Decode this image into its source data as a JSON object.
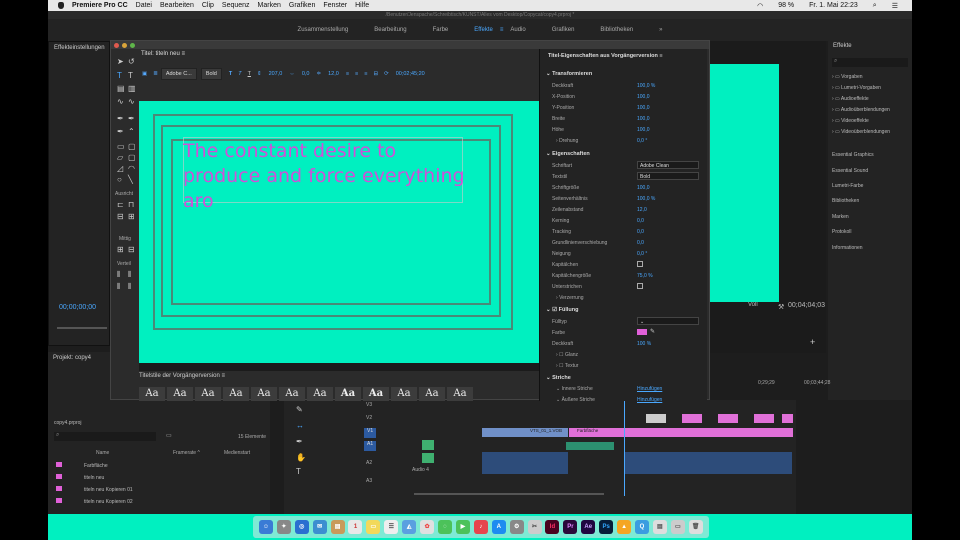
{
  "menubar": {
    "app_name": "Premiere Pro CC",
    "items": [
      "Datei",
      "Bearbeiten",
      "Clip",
      "Sequenz",
      "Marken",
      "Grafiken",
      "Fenster",
      "Hilfe"
    ],
    "battery": "98 %",
    "clock": "Fr. 1. Mai  22:23"
  },
  "path": "/Benutzer/Jenspache/Schreibtisch/KUNST/Alles vom Desktop/Copycat/copy4.prproj *",
  "workspaces": {
    "tabs": [
      "Zusammenstellung",
      "Bearbeitung",
      "Farbe",
      "Effekte",
      "Audio",
      "Grafiken",
      "Bibliotheken"
    ],
    "active": "Effekte",
    "more": "»"
  },
  "left_panel": {
    "title": "Effekteinstellungen",
    "timecode": "00;00;00;00"
  },
  "title_window": {
    "tab": "Titel: titeln neu",
    "font_family": "Adobe C...",
    "font_style": "Bold",
    "size_value": "207,0",
    "kerning_value": "0,0",
    "leading_value": "12,0",
    "timecode": "00;02;45;20",
    "text_content": "The constant desire to produce and force everything aro",
    "sections": {
      "ausrichten": "Ausricht",
      "mittig": "Mittig",
      "verteilen": "Verteil"
    }
  },
  "properties": {
    "title": "Titel-Eigenschaften aus Vorgängerversion",
    "transformieren": "Transformieren",
    "deckkraft_label": "Deckkraft",
    "deckkraft": "100,0 %",
    "xpos_label": "X-Position",
    "xpos": "100,0",
    "ypos_label": "Y-Position",
    "ypos": "100,0",
    "breite_label": "Breite",
    "breite": "100,0",
    "hoehe_label": "Höhe",
    "hoehe": "100,0",
    "drehung_label": "Drehung",
    "drehung": "0,0 °",
    "eigenschaften": "Eigenschaften",
    "schriftart_label": "Schriftart",
    "schriftart": "Adobe Clean",
    "textstil_label": "Textstil",
    "textstil": "Bold",
    "groesse_label": "Schriftgröße",
    "groesse": "100,0",
    "seiten_label": "Seitenverhältnis",
    "seiten": "100,0 %",
    "zeilen_label": "Zeilenabstand",
    "zeilen": "12,0",
    "kerning_label": "Kerning",
    "kerning": "0,0",
    "tracking_label": "Tracking",
    "tracking": "0,0",
    "grund_label": "Grundlinienverschiebung",
    "grund": "0,0",
    "neigung_label": "Neigung",
    "neigung": "0,0 °",
    "kapit_label": "Kapitälchen",
    "kapitgr_label": "Kapitälchengröße",
    "kapitgr": "75,0 %",
    "unter_label": "Unterstrichen",
    "verzerrung_label": "Verzerrung",
    "fuellung": "Füllung",
    "fuelltyp_label": "Fülltyp",
    "farbe_label": "Farbe",
    "deckkraft2_label": "Deckkraft",
    "deckkraft2": "100 %",
    "glanz_label": "Glanz",
    "textur_label": "Textur",
    "striche": "Striche",
    "innere_label": "Innere Striche",
    "innere": "Hinzufügen",
    "aeussere_label": "Äußere Striche",
    "aeussere": "Hinzufügen",
    "schatten": "Schatten"
  },
  "styles": {
    "title": "Titelstile der Vorgängerversion",
    "sample": "Aa"
  },
  "program": {
    "timecode": "00;04;04;03",
    "scale": "Voll"
  },
  "effekte": {
    "title": "Effekte",
    "items": [
      "Vorgaben",
      "Lumetri-Vorgaben",
      "Audioeffekte",
      "Audioüberblendungen",
      "Videoeffekte",
      "Videoüberblendungen"
    ],
    "panels": [
      "Essential Graphics",
      "Essential Sound",
      "Lumetri-Farbe",
      "Bibliotheken",
      "Marken",
      "Protokoll",
      "Informationen"
    ]
  },
  "project": {
    "title": "Projekt: copy4",
    "file": "copy4.prproj",
    "count": "15 Elemente",
    "col_name": "Name",
    "col_rate": "Framerate",
    "col_start": "Medienstart",
    "rows": [
      "Farbfläche",
      "titeln neu",
      "titeln neu Kopieren 01",
      "titeln neu Kopieren 02"
    ]
  },
  "timeline": {
    "ruler": [
      "0;29;29",
      "00;03;44;28"
    ],
    "tracks": [
      "V3",
      "V2",
      "V1",
      "A1",
      "A2",
      "A3"
    ],
    "audio_name": "Audio 4",
    "clip_video": "VTS_01_1.VOB",
    "clip_color": "Farbfläche"
  },
  "colors": {
    "accent": "#4aa8ff",
    "canvas": "#00f0c0",
    "title_text": "#d050d8"
  }
}
